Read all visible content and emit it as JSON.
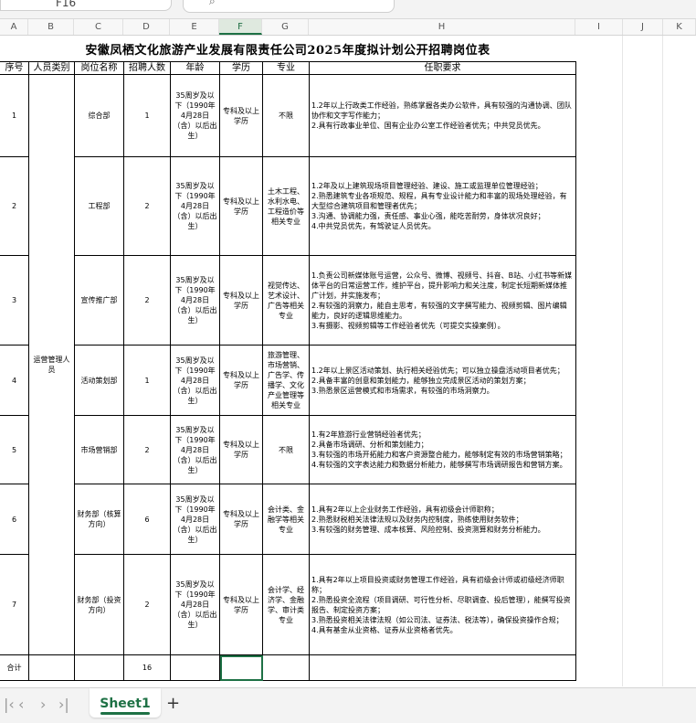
{
  "namebox": {
    "value": "F16"
  },
  "columns": [
    "A",
    "B",
    "C",
    "D",
    "E",
    "F",
    "G",
    "H",
    "I",
    "J",
    "K"
  ],
  "selected_column": "F",
  "sheet_title": "安徽凤栖文化旅游产业发展有限责任公司2025年度拟计划公开招聘岗位表",
  "headers": {
    "seq": "序号",
    "category": "人员类别",
    "position": "岗位名称",
    "count": "招聘人数",
    "age": "年龄",
    "edu": "学历",
    "major": "专业",
    "req": "任职要求"
  },
  "category_merged": "运营管理人员",
  "rows": [
    {
      "seq": "1",
      "position": "综合部",
      "count": "1",
      "age": "35周岁及以下（1990年4月28日（含）以后出生）",
      "edu": "专科及以上学历",
      "major": "不限",
      "req": "1.2年以上行政类工作经验，熟练掌握各类办公软件，具有较强的沟通协调、团队协作和文字写作能力；\n2.具有行政事业单位、国有企业办公室工作经验者优先；中共党员优先。"
    },
    {
      "seq": "2",
      "position": "工程部",
      "count": "2",
      "age": "35周岁及以下（1990年4月28日（含）以后出生）",
      "edu": "专科及以上学历",
      "major": "土木工程、水利水电、工程造价等相关专业",
      "req": "1.2年及以上建筑现场项目管理经验、建设、施工或监理单位管理经验；\n2.熟悉建筑专业各项规范、规程，具有专业设计能力和丰富的现场处理经验，有大型综合建筑项目和管理者优先；\n3.沟通、协调能力强，责任感、事业心强，能吃苦耐劳，身体状况良好；\n4.中共党员优先，有驾驶证人员优先。"
    },
    {
      "seq": "3",
      "position": "宣传推广部",
      "count": "2",
      "age": "35周岁及以下（1990年4月28日（含）以后出生）",
      "edu": "专科及以上学历",
      "major": "视觉传达、艺术设计、广告等相关专业",
      "req": "1.负责公司新媒体账号运营，公众号、微博、视频号、抖音、B站、小红书等新媒体平台的日常运营工作，维护平台，提升影响力和关注度，制定长短期新媒体推广计划，并实施发布；\n2.有较强的洞察力，能自主思考，有较强的文字撰写能力、视频剪辑、图片编辑能力，良好的逻辑思维能力。\n3.有摄影、视频剪辑等工作经验者优先（可提交实操案例）。"
    },
    {
      "seq": "4",
      "position": "活动策划部",
      "count": "1",
      "age": "35周岁及以下（1990年4月28日（含）以后出生）",
      "edu": "专科及以上学历",
      "major": "旅游管理、市场营销、广告学、传播学、文化产业管理等相关专业",
      "req": "1.2年以上景区活动策划、执行相关经验优先；可以独立操盘活动项目者优先；\n2.具备丰富的创意和策划能力，能够独立完成景区活动的策划方案；\n3.熟悉景区运营模式和市场需求，有较强的市场洞察力。"
    },
    {
      "seq": "5",
      "position": "市场营销部",
      "count": "2",
      "age": "35周岁及以下（1990年4月28日（含）以后出生）",
      "edu": "专科及以上学历",
      "major": "不限",
      "req": "1.有2年旅游行业营销经验者优先；\n2.具备市场调研、分析和策划能力；\n3.有较强的市场开拓能力和客户资源整合能力，能够制定有效的市场营销策略；\n4.有较强的文字表达能力和数据分析能力，能够撰写市场调研报告和营销方案。"
    },
    {
      "seq": "6",
      "position": "财务部（核算方向）",
      "count": "6",
      "age": "35周岁及以下（1990年4月28日（含）以后出生）",
      "edu": "专科及以上学历",
      "major": "会计类、金融学等相关专业",
      "req": "1.具有2年以上企业财务工作经验，具有初级会计师职称；\n2.熟悉财税相关法律法规以及财务内控制度，熟练使用财务软件；\n3.有较强的财务管理、成本核算、风险控制、投资测算和财务分析能力。"
    },
    {
      "seq": "7",
      "position": "财务部（投资方向）",
      "count": "2",
      "age": "35周岁及以下（1990年4月28日（含）以后出生）",
      "edu": "专科及以上学历",
      "major": "会计学、经济学、金融学、审计类专业",
      "req": "1.具有2年以上项目投资或财务管理工作经验，具有初级会计师或初级经济师职称；\n2.熟悉投资全流程（项目调研、可行性分析、尽职调查、投后管理），能撰写投资报告、制定投资方案；\n3.熟悉投资相关法律法规（如公司法、证券法、税法等），确保投资操作合规；\n4.具有基金从业资格、证券从业资格者优先。"
    }
  ],
  "total": {
    "label": "合计",
    "count": "16"
  },
  "tabs": {
    "sheet1": "Sheet1"
  }
}
